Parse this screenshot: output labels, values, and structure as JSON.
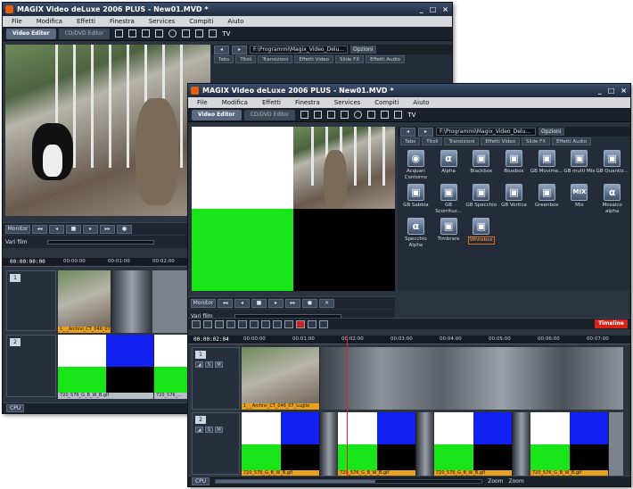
{
  "back_window": {
    "title": "MAGIX Video deLuxe 2006 PLUS - New01.MVD *",
    "window_buttons": [
      "_",
      "□",
      "×"
    ],
    "menu": [
      "File",
      "Modifica",
      "Effetti",
      "Finestra",
      "Services",
      "Compiti",
      "Aiuto"
    ],
    "tabs": [
      "Video Editor",
      "CD/DVD Editor"
    ],
    "tv_label": "TV",
    "path": "F:\\Programmi\\Magix_Video_Delu...",
    "options_label": "Opzioni",
    "fx_tabs": [
      "Tabs",
      "Titoli",
      "Transizioni",
      "Effetti Video",
      "Slide FX",
      "Effetti Audio"
    ],
    "transport": {
      "monitor_label": "Monitor",
      "extra_label": "Vari film"
    },
    "timecode": "00:00:00:00",
    "ruler_ticks": [
      "00:00:00",
      "00:01:00",
      "00:02:00"
    ],
    "track1_label": "1_ _Archivi_CT_046_07_Luglio",
    "track2_label": "720_576_G_B_W_B.gif",
    "track2_label_b": "720_576_...",
    "status": {
      "cpu": "CPU"
    }
  },
  "front_window": {
    "title": "MAGIX Video deLuxe 2006 PLUS - New01.MVD *",
    "window_buttons": [
      "_",
      "□",
      "×"
    ],
    "menu": [
      "File",
      "Modifica",
      "Effetti",
      "Finestra",
      "Services",
      "Compiti",
      "Aiuto"
    ],
    "tabs": [
      "Video Editor",
      "CD/DVD Editor"
    ],
    "tv_label": "TV",
    "path": "F:\\Programmi\\Magix_Video_Delu...",
    "options_label": "Opzioni",
    "fx_tabs": [
      "Tabs",
      "Titoli",
      "Transizioni",
      "Effetti Video",
      "Slide FX",
      "Effetti Audio"
    ],
    "effects": [
      {
        "name": "Acquari Contorno",
        "icon": "acquarello-icon",
        "glyph": "◉"
      },
      {
        "name": "Alpha",
        "icon": "alpha-icon",
        "glyph": "α"
      },
      {
        "name": "Blackbox",
        "icon": "blackbox-icon",
        "glyph": "▣"
      },
      {
        "name": "Bluebox",
        "icon": "bluebox-icon",
        "glyph": "▣"
      },
      {
        "name": "GB Movime...",
        "icon": "gb-movement-icon",
        "glyph": "▣"
      },
      {
        "name": "GB multi Mix",
        "icon": "gb-multimix-icon",
        "glyph": "▣"
      },
      {
        "name": "GB Quantiz...",
        "icon": "gb-quantize-icon",
        "glyph": "▣"
      },
      {
        "name": "GB Sabbia",
        "icon": "gb-sand-icon",
        "glyph": "▣"
      },
      {
        "name": "GB Scorrituz...",
        "icon": "gb-scroll-icon",
        "glyph": "▣"
      },
      {
        "name": "GB Specchio",
        "icon": "gb-mirror-icon",
        "glyph": "▣"
      },
      {
        "name": "GB Vortice",
        "icon": "gb-vortex-icon",
        "glyph": "▣"
      },
      {
        "name": "Greenbox",
        "icon": "greenbox-icon",
        "glyph": "▣"
      },
      {
        "name": "Mix",
        "icon": "mix-icon",
        "glyph": "MIX"
      },
      {
        "name": "Mosaico alpha",
        "icon": "mosaic-alpha-icon",
        "glyph": "α"
      },
      {
        "name": "Specchio Alpha",
        "icon": "mirror-alpha-icon",
        "glyph": "α"
      },
      {
        "name": "Timbrare",
        "icon": "stamp-icon",
        "glyph": "▣"
      },
      {
        "name": "Whitebox",
        "icon": "whitebox-icon",
        "glyph": "▣"
      }
    ],
    "selected_effect": "Whitebox",
    "transport": {
      "monitor_label": "Monitor",
      "extra_label": "Vari film"
    },
    "timeline_button": "Timeline",
    "timecode": "00:00:02:04",
    "ruler_ticks": [
      "00:00:00",
      "00:01:00",
      "00:02:00",
      "00:03:00",
      "00:04:00",
      "00:05:00",
      "00:06:00",
      "00:07:00"
    ],
    "track_numbers": [
      "1",
      "2"
    ],
    "track_buttons": [
      "◢",
      "S",
      "M"
    ],
    "track1_label": "1_ _Archivi_CT_046_07_Luglio",
    "track2_labels": [
      "720_576_G_B_W_B.gif",
      "720_576_G_B_W_B.gif",
      "720_576_G_B_W_B.gif",
      "720_576_G_B_W_B.gif"
    ],
    "status": {
      "cpu": "CPU",
      "zoom": "Zoom",
      "zoom_label": "Zoom"
    },
    "colors": {
      "green": "#19e619",
      "blue": "#1020f0",
      "white": "#ffffff",
      "black": "#000000",
      "clip_label": "#e9a11c",
      "playhead": "#e02020"
    }
  }
}
